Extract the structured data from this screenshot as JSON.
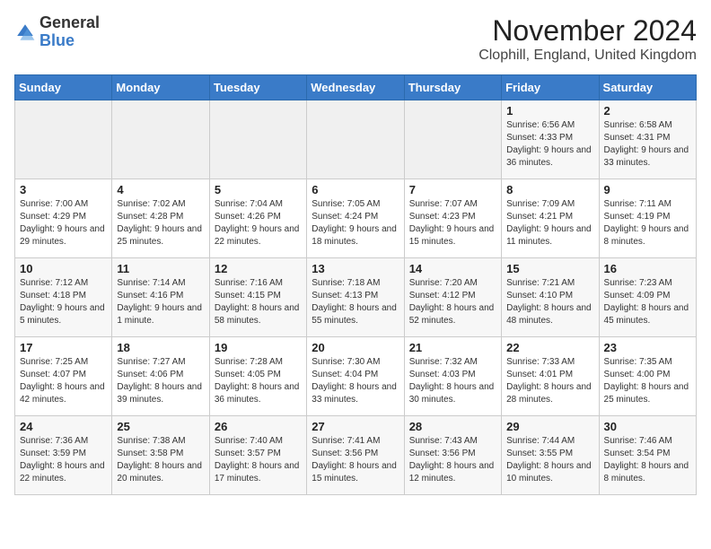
{
  "header": {
    "logo_general": "General",
    "logo_blue": "Blue",
    "month_title": "November 2024",
    "location": "Clophill, England, United Kingdom"
  },
  "days_of_week": [
    "Sunday",
    "Monday",
    "Tuesday",
    "Wednesday",
    "Thursday",
    "Friday",
    "Saturday"
  ],
  "weeks": [
    [
      {
        "day": "",
        "info": ""
      },
      {
        "day": "",
        "info": ""
      },
      {
        "day": "",
        "info": ""
      },
      {
        "day": "",
        "info": ""
      },
      {
        "day": "",
        "info": ""
      },
      {
        "day": "1",
        "info": "Sunrise: 6:56 AM\nSunset: 4:33 PM\nDaylight: 9 hours and 36 minutes."
      },
      {
        "day": "2",
        "info": "Sunrise: 6:58 AM\nSunset: 4:31 PM\nDaylight: 9 hours and 33 minutes."
      }
    ],
    [
      {
        "day": "3",
        "info": "Sunrise: 7:00 AM\nSunset: 4:29 PM\nDaylight: 9 hours and 29 minutes."
      },
      {
        "day": "4",
        "info": "Sunrise: 7:02 AM\nSunset: 4:28 PM\nDaylight: 9 hours and 25 minutes."
      },
      {
        "day": "5",
        "info": "Sunrise: 7:04 AM\nSunset: 4:26 PM\nDaylight: 9 hours and 22 minutes."
      },
      {
        "day": "6",
        "info": "Sunrise: 7:05 AM\nSunset: 4:24 PM\nDaylight: 9 hours and 18 minutes."
      },
      {
        "day": "7",
        "info": "Sunrise: 7:07 AM\nSunset: 4:23 PM\nDaylight: 9 hours and 15 minutes."
      },
      {
        "day": "8",
        "info": "Sunrise: 7:09 AM\nSunset: 4:21 PM\nDaylight: 9 hours and 11 minutes."
      },
      {
        "day": "9",
        "info": "Sunrise: 7:11 AM\nSunset: 4:19 PM\nDaylight: 9 hours and 8 minutes."
      }
    ],
    [
      {
        "day": "10",
        "info": "Sunrise: 7:12 AM\nSunset: 4:18 PM\nDaylight: 9 hours and 5 minutes."
      },
      {
        "day": "11",
        "info": "Sunrise: 7:14 AM\nSunset: 4:16 PM\nDaylight: 9 hours and 1 minute."
      },
      {
        "day": "12",
        "info": "Sunrise: 7:16 AM\nSunset: 4:15 PM\nDaylight: 8 hours and 58 minutes."
      },
      {
        "day": "13",
        "info": "Sunrise: 7:18 AM\nSunset: 4:13 PM\nDaylight: 8 hours and 55 minutes."
      },
      {
        "day": "14",
        "info": "Sunrise: 7:20 AM\nSunset: 4:12 PM\nDaylight: 8 hours and 52 minutes."
      },
      {
        "day": "15",
        "info": "Sunrise: 7:21 AM\nSunset: 4:10 PM\nDaylight: 8 hours and 48 minutes."
      },
      {
        "day": "16",
        "info": "Sunrise: 7:23 AM\nSunset: 4:09 PM\nDaylight: 8 hours and 45 minutes."
      }
    ],
    [
      {
        "day": "17",
        "info": "Sunrise: 7:25 AM\nSunset: 4:07 PM\nDaylight: 8 hours and 42 minutes."
      },
      {
        "day": "18",
        "info": "Sunrise: 7:27 AM\nSunset: 4:06 PM\nDaylight: 8 hours and 39 minutes."
      },
      {
        "day": "19",
        "info": "Sunrise: 7:28 AM\nSunset: 4:05 PM\nDaylight: 8 hours and 36 minutes."
      },
      {
        "day": "20",
        "info": "Sunrise: 7:30 AM\nSunset: 4:04 PM\nDaylight: 8 hours and 33 minutes."
      },
      {
        "day": "21",
        "info": "Sunrise: 7:32 AM\nSunset: 4:03 PM\nDaylight: 8 hours and 30 minutes."
      },
      {
        "day": "22",
        "info": "Sunrise: 7:33 AM\nSunset: 4:01 PM\nDaylight: 8 hours and 28 minutes."
      },
      {
        "day": "23",
        "info": "Sunrise: 7:35 AM\nSunset: 4:00 PM\nDaylight: 8 hours and 25 minutes."
      }
    ],
    [
      {
        "day": "24",
        "info": "Sunrise: 7:36 AM\nSunset: 3:59 PM\nDaylight: 8 hours and 22 minutes."
      },
      {
        "day": "25",
        "info": "Sunrise: 7:38 AM\nSunset: 3:58 PM\nDaylight: 8 hours and 20 minutes."
      },
      {
        "day": "26",
        "info": "Sunrise: 7:40 AM\nSunset: 3:57 PM\nDaylight: 8 hours and 17 minutes."
      },
      {
        "day": "27",
        "info": "Sunrise: 7:41 AM\nSunset: 3:56 PM\nDaylight: 8 hours and 15 minutes."
      },
      {
        "day": "28",
        "info": "Sunrise: 7:43 AM\nSunset: 3:56 PM\nDaylight: 8 hours and 12 minutes."
      },
      {
        "day": "29",
        "info": "Sunrise: 7:44 AM\nSunset: 3:55 PM\nDaylight: 8 hours and 10 minutes."
      },
      {
        "day": "30",
        "info": "Sunrise: 7:46 AM\nSunset: 3:54 PM\nDaylight: 8 hours and 8 minutes."
      }
    ]
  ]
}
